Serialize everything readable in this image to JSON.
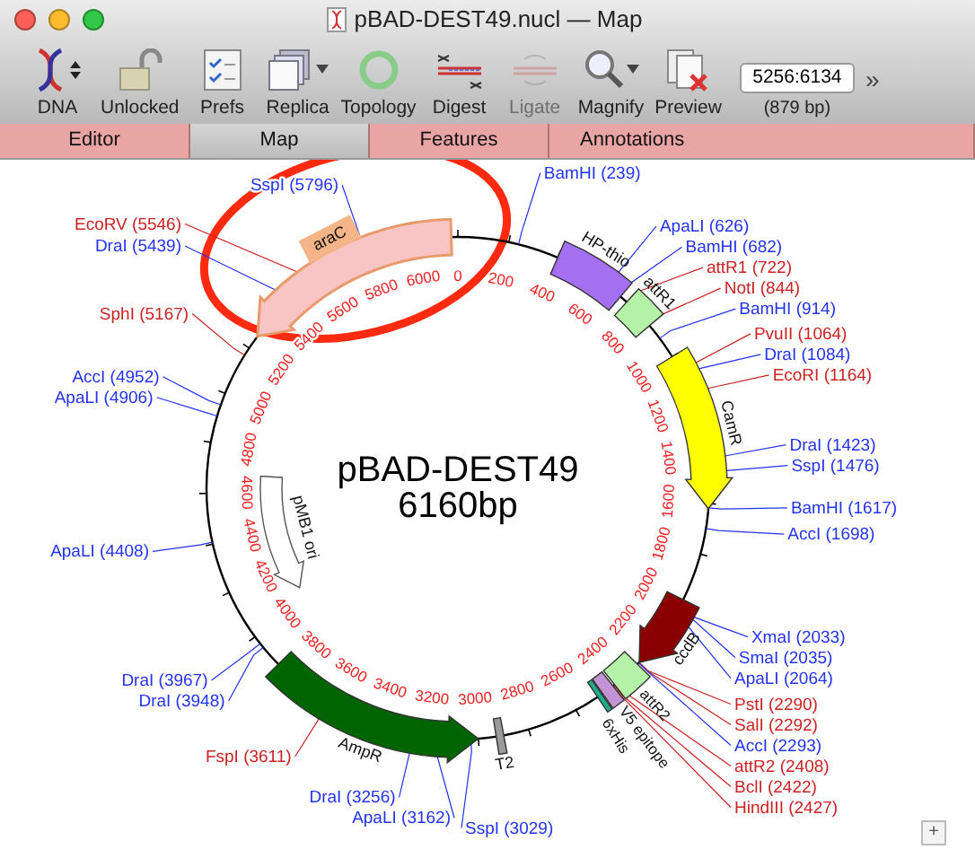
{
  "window": {
    "title": "pBAD-DEST49.nucl — Map"
  },
  "toolbar": [
    {
      "label": "DNA",
      "kind": "stepper",
      "disabled": false
    },
    {
      "label": "Unlocked",
      "kind": "plain",
      "disabled": false
    },
    {
      "label": "Prefs",
      "kind": "plain",
      "disabled": false
    },
    {
      "label": "Replica",
      "kind": "dropdown",
      "disabled": false
    },
    {
      "label": "Topology",
      "kind": "plain",
      "disabled": false
    },
    {
      "label": "Digest",
      "kind": "plain",
      "disabled": false
    },
    {
      "label": "Ligate",
      "kind": "plain",
      "disabled": true
    },
    {
      "label": "Magnify",
      "kind": "dropdown",
      "disabled": false
    },
    {
      "label": "Preview",
      "kind": "plain",
      "disabled": false
    }
  ],
  "selection": {
    "value": "5256:6134",
    "length": "(879 bp)"
  },
  "overflow": "»",
  "tabs": [
    {
      "label": "Editor",
      "selected": false
    },
    {
      "label": "Map",
      "selected": true
    },
    {
      "label": "Features",
      "selected": false
    },
    {
      "label": "Annotations",
      "selected": false
    }
  ],
  "map": {
    "name": "pBAD-DEST49",
    "size": "6160bp",
    "ticks": [
      "0",
      "200",
      "400",
      "600",
      "800",
      "1000",
      "1200",
      "1400",
      "1600",
      "1800",
      "2000",
      "2200",
      "2400",
      "2600",
      "2800",
      "3000",
      "3200",
      "3400",
      "3600",
      "3800",
      "4000",
      "4200",
      "4400",
      "4600",
      "4800",
      "5000",
      "5200",
      "5400",
      "5600",
      "5800",
      "6000"
    ],
    "features": [
      {
        "label": "araC",
        "color": "#f9c4c4",
        "selected": true
      },
      {
        "label": "HP-thio",
        "color": "#a56ff2",
        "selected": false
      },
      {
        "label": "attR1",
        "color": "#b4f2a8",
        "selected": false
      },
      {
        "label": "CamR",
        "color": "#ffff00",
        "selected": false
      },
      {
        "label": "ccdB",
        "color": "#8b0000",
        "selected": false
      },
      {
        "label": "attR2",
        "color": "#b4f2a8",
        "selected": false
      },
      {
        "label": "V5 epitope",
        "color": "#c493d6",
        "selected": false
      },
      {
        "label": "6xHis",
        "color": "#1fae8c",
        "selected": false
      },
      {
        "label": "T2",
        "color": "#9a9a9a",
        "selected": false
      },
      {
        "label": "AmpR",
        "color": "#006400",
        "selected": false
      },
      {
        "label": "pMB1 ori",
        "color": "#ffffff",
        "selected": false
      }
    ],
    "sites": [
      {
        "label": "BamHI (239)",
        "color": "#2233ee"
      },
      {
        "label": "ApaLI (626)",
        "color": "#2233ee"
      },
      {
        "label": "BamHI (682)",
        "color": "#2233ee"
      },
      {
        "label": "attR1 (722)",
        "color": "#cc2222"
      },
      {
        "label": "NotI (844)",
        "color": "#cc2222"
      },
      {
        "label": "BamHI (914)",
        "color": "#2233ee"
      },
      {
        "label": "PvuII (1064)",
        "color": "#cc2222"
      },
      {
        "label": "DraI (1084)",
        "color": "#2233ee"
      },
      {
        "label": "EcoRI (1164)",
        "color": "#cc2222"
      },
      {
        "label": "DraI (1423)",
        "color": "#2233ee"
      },
      {
        "label": "SspI (1476)",
        "color": "#2233ee"
      },
      {
        "label": "BamHI (1617)",
        "color": "#2233ee"
      },
      {
        "label": "AccI (1698)",
        "color": "#2233ee"
      },
      {
        "label": "XmaI (2033)",
        "color": "#2233ee"
      },
      {
        "label": "SmaI (2035)",
        "color": "#2233ee"
      },
      {
        "label": "ApaLI (2064)",
        "color": "#2233ee"
      },
      {
        "label": "PstI (2290)",
        "color": "#cc2222"
      },
      {
        "label": "SalI (2292)",
        "color": "#cc2222"
      },
      {
        "label": "AccI (2293)",
        "color": "#2233ee"
      },
      {
        "label": "attR2 (2408)",
        "color": "#cc2222"
      },
      {
        "label": "BclI (2422)",
        "color": "#cc2222"
      },
      {
        "label": "HindIII (2427)",
        "color": "#cc2222"
      },
      {
        "label": "SspI (3029)",
        "color": "#2233ee"
      },
      {
        "label": "SspI (5796)",
        "color": "#2233ee"
      },
      {
        "label": "EcoRV (5546)",
        "color": "#cc2222"
      },
      {
        "label": "DraI (5439)",
        "color": "#2233ee"
      },
      {
        "label": "SphI (5167)",
        "color": "#cc2222"
      },
      {
        "label": "AccI (4952)",
        "color": "#2233ee"
      },
      {
        "label": "ApaLI (4906)",
        "color": "#2233ee"
      },
      {
        "label": "ApaLI (4408)",
        "color": "#2233ee"
      },
      {
        "label": "DraI (3967)",
        "color": "#2233ee"
      },
      {
        "label": "DraI (3948)",
        "color": "#2233ee"
      },
      {
        "label": "FspI (3611)",
        "color": "#cc2222"
      },
      {
        "label": "DraI (3256)",
        "color": "#2233ee"
      },
      {
        "label": "ApaLI (3162)",
        "color": "#2233ee"
      }
    ]
  },
  "zoom_button": "+"
}
